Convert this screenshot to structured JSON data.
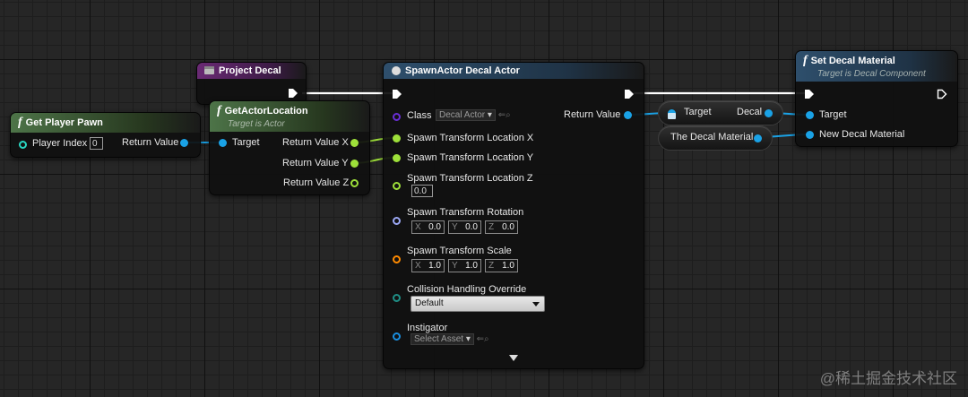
{
  "nodes": {
    "get_player_pawn": {
      "title": "Get Player Pawn",
      "player_index_label": "Player Index",
      "player_index_value": "0",
      "return_label": "Return Value"
    },
    "project_decal": {
      "title": "Project Decal"
    },
    "get_actor_location": {
      "title": "GetActorLocation",
      "subtitle": "Target is Actor",
      "target_label": "Target",
      "ret_x": "Return Value X",
      "ret_y": "Return Value Y",
      "ret_z": "Return Value Z"
    },
    "spawn_actor": {
      "title": "SpawnActor Decal Actor",
      "class_label": "Class",
      "class_value": "Decal Actor",
      "loc_x": "Spawn Transform Location X",
      "loc_y": "Spawn Transform Location Y",
      "loc_z": "Spawn Transform Location Z",
      "loc_z_value": "0.0",
      "rotation_label": "Spawn Transform Rotation",
      "rotation": {
        "x": "0.0",
        "y": "0.0",
        "z": "0.0"
      },
      "scale_label": "Spawn Transform Scale",
      "scale": {
        "x": "1.0",
        "y": "1.0",
        "z": "1.0"
      },
      "axis": {
        "x": "X",
        "y": "Y",
        "z": "Z"
      },
      "collision_label": "Collision Handling Override",
      "collision_value": "Default",
      "instigator_label": "Instigator",
      "instigator_value": "Select Asset",
      "return_label": "Return Value"
    },
    "target_decal": {
      "target_label": "Target",
      "decal_label": "Decal"
    },
    "decal_material_var": {
      "label": "The Decal Material"
    },
    "set_decal_material": {
      "title": "Set Decal Material",
      "subtitle": "Target is Decal Component",
      "target_label": "Target",
      "new_material_label": "New Decal Material"
    }
  },
  "colors": {
    "object_pin": "#1aa2e6",
    "float_pin": "#9ee03a",
    "exec_wire": "#ffffff"
  },
  "watermark": "@稀土掘金技术社区"
}
